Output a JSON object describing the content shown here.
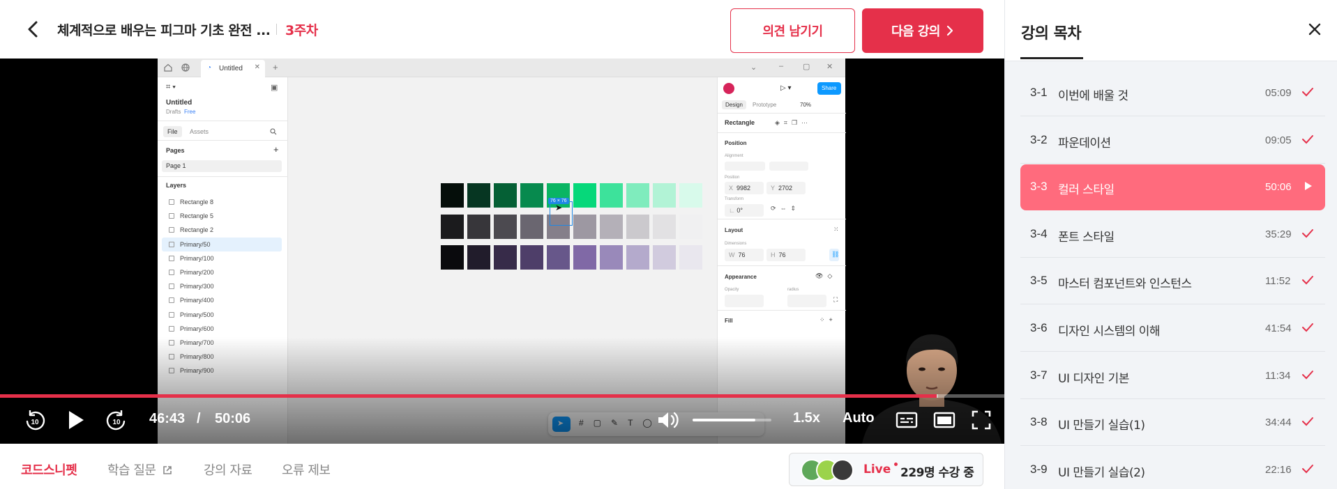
{
  "header": {
    "course_title": "체계적으로 배우는 피그마 기초 완전 ...",
    "week": "3주차",
    "feedback_label": "의견 남기기",
    "next_label": "다음 강의"
  },
  "player": {
    "current_time": "46:43",
    "separator": "/",
    "duration": "50:06",
    "progress": 0.9325,
    "buffered": 0.934,
    "volume": 0.8,
    "speed": "1.5x",
    "quality": "Auto"
  },
  "figma": {
    "tab_title": "Untitled",
    "file_name": "Untitled",
    "drafts": "Drafts",
    "plan_badge": "Free",
    "left_tabs": [
      "File",
      "Assets"
    ],
    "pages_heading": "Pages",
    "page_item": "Page 1",
    "layers_heading": "Layers",
    "layers": [
      "Rectangle 8",
      "Rectangle 5",
      "Rectangle 2",
      "Primary/50",
      "Primary/100",
      "Primary/200",
      "Primary/300",
      "Primary/400",
      "Primary/500",
      "Primary/600",
      "Primary/700",
      "Primary/800",
      "Primary/900"
    ],
    "selected_layer": "Primary/50",
    "share_label": "Share",
    "design_tab": "Design",
    "prototype_tab": "Prototype",
    "zoom": "70%",
    "selection_type": "Rectangle",
    "position_heading": "Position",
    "alignment_label": "Alignment",
    "position_label": "Position",
    "x_label": "X",
    "x_value": "9982",
    "y_label": "Y",
    "y_value": "2702",
    "transform_label": "Transform",
    "rotation": "0°",
    "layout_heading": "Layout",
    "dimensions_label": "Dimensions",
    "w_label": "W",
    "w_value": "76",
    "h_label": "H",
    "h_value": "76",
    "appearance_heading": "Appearance",
    "opacity_label": "Opacity",
    "radius_label": "radius",
    "fill_heading": "Fill",
    "size_badge": "76 × 76",
    "swatch_rows": [
      [
        "#050e0a",
        "#063622",
        "#056035",
        "#078a4e",
        "#0ab563",
        "#06d87a",
        "#3de29b",
        "#7fecbd",
        "#b2f3d6",
        "#d8faeb"
      ],
      [
        "#1b1b1d",
        "#37363a",
        "#4c4a50",
        "#6a6670",
        "#857f8a",
        "#9d98a2",
        "#b4b0b8",
        "#cbc9cd",
        "#e2e1e3",
        "#f0f0f1"
      ],
      [
        "#0a0a0d",
        "#211c2b",
        "#372b49",
        "#4e3e69",
        "#67578a",
        "#8069a6",
        "#9989ba",
        "#b4aacc",
        "#d1cbde",
        "#e9e7ee"
      ]
    ]
  },
  "bottom_tabs": {
    "codesnippet": "코드스니펫",
    "questions": "학습 질문",
    "materials": "강의 자료",
    "report": "오류 제보"
  },
  "live": {
    "label": "Live",
    "count": "229명 수강 중"
  },
  "sidebar": {
    "title": "강의 목차",
    "lectures": [
      {
        "num": "3-1",
        "title": "이번에 배울 것",
        "duration": "05:09",
        "status": "done"
      },
      {
        "num": "3-2",
        "title": "파운데이션",
        "duration": "09:05",
        "status": "done"
      },
      {
        "num": "3-3",
        "title": "컬러 스타일",
        "duration": "50:06",
        "status": "playing"
      },
      {
        "num": "3-4",
        "title": "폰트 스타일",
        "duration": "35:29",
        "status": "done"
      },
      {
        "num": "3-5",
        "title": "마스터 컴포넌트와 인스턴스",
        "duration": "11:52",
        "status": "done"
      },
      {
        "num": "3-6",
        "title": "디자인 시스템의 이해",
        "duration": "41:54",
        "status": "done"
      },
      {
        "num": "3-7",
        "title": "UI 디자인 기본",
        "duration": "11:34",
        "status": "done"
      },
      {
        "num": "3-8",
        "title": "UI 만들기 실습(1)",
        "duration": "34:44",
        "status": "done"
      },
      {
        "num": "3-9",
        "title": "UI 만들기 실습(2)",
        "duration": "22:16",
        "status": "done"
      }
    ]
  },
  "colors": {
    "accent": "#e5304a",
    "current_lecture_bg": "#ff6b7d",
    "check": "#e5304a"
  }
}
